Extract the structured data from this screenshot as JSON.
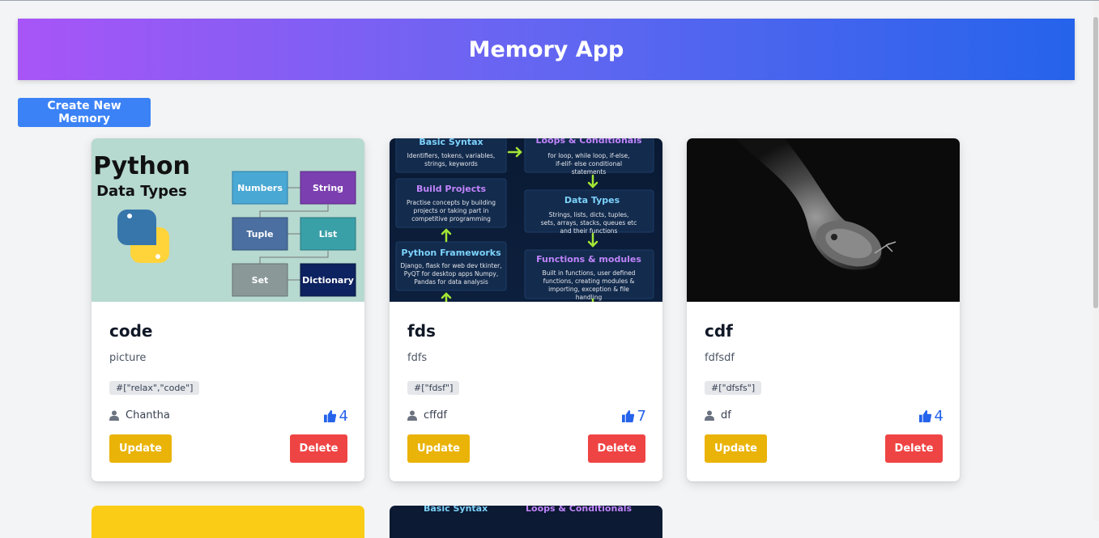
{
  "app": {
    "title": "Memory App"
  },
  "toolbar": {
    "create_label": "Create New Memory"
  },
  "memories": [
    {
      "title": "code",
      "description": "picture",
      "tags": "#[\"relax\",\"code\"]",
      "author": "Chantha",
      "likes": "4",
      "image": {
        "heading1": "Python",
        "heading2": "Data Types",
        "boxes": [
          "Numbers",
          "String",
          "Tuple",
          "List",
          "Set",
          "Dictionary"
        ]
      }
    },
    {
      "title": "fds",
      "description": "fdfs",
      "tags": "#[\"fdsf\"]",
      "author": "cffdf",
      "likes": "7",
      "image": {
        "blocks": [
          {
            "title": "Basic Syntax",
            "text": "Identifiers, tokens, variables, strings, keywords"
          },
          {
            "title": "Loops & Conditionals",
            "text": "for loop, while loop, if-else, if-elif- else conditional statements"
          },
          {
            "title": "Build Projects",
            "text": "Practise concepts by building projects or taking part in competitive programming"
          },
          {
            "title": "Data Types",
            "text": "Strings, lists, dicts, tuples, sets, arrays, stacks, queues etc and their functions"
          },
          {
            "title": "Python Frameworks",
            "text": "Django, flask for web dev tkinter, PyQT for desktop apps Numpy, Pandas for data analysis"
          },
          {
            "title": "Functions & modules",
            "text": "Built in functions, user defined functions, creating modules & importing, exception & file handling"
          }
        ]
      }
    },
    {
      "title": "cdf",
      "description": "fdfsdf",
      "tags": "#[\"dfsfs\"]",
      "author": "df",
      "likes": "4",
      "image": {}
    }
  ],
  "partial": {
    "t1": "Basic Syntax",
    "t2": "Loops & Conditionals"
  },
  "buttons": {
    "update": "Update",
    "delete": "Delete"
  },
  "icons": {
    "author": "user-icon",
    "likes": "thumbs-up-icon"
  },
  "colors": {
    "header_start": "#a855f7",
    "header_end": "#2563eb",
    "primary": "#3b82f6",
    "update": "#eab308",
    "delete": "#ef4444",
    "like": "#2563eb"
  }
}
